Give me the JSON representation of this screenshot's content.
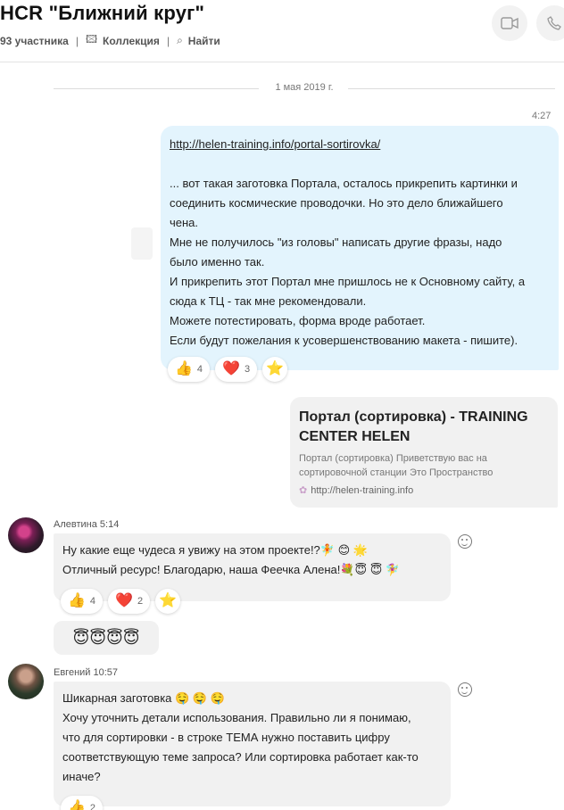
{
  "header": {
    "title": "HCR \"Ближний круг\"",
    "participants": "93 участника",
    "collection_label": "Коллекция",
    "find_label": "Найти"
  },
  "date_divider": "1 мая 2019 г.",
  "outgoing": {
    "time": "4:27",
    "link": "http://helen-training.info/portal-sortirovka/",
    "lines": [
      "... вот такая заготовка Портала, осталось прикрепить картинки и",
      "соединить космические проводочки. Но это дело ближайшего",
      "чена.",
      "Мне не получилось \"из головы\" написать другие фразы, надо",
      "было именно так.",
      "И прикрепить этот Портал мне пришлось не к Основному сайту, а",
      "сюда к ТЦ - так мне рекомендовали.",
      "Можете потестировать, форма вроде работает.",
      "Если будут пожелания к усовершенствованию макета - пишите)."
    ],
    "reactions": [
      {
        "emoji": "👍",
        "count": "4"
      },
      {
        "emoji": "❤️",
        "count": "3"
      },
      {
        "emoji": "⭐",
        "count": ""
      }
    ]
  },
  "link_card": {
    "title": "Портал (сортировка) - TRAINING CENTER HELEN",
    "description": "Портал (сортировка) Приветствую вас на сортировочной станции Это Пространство",
    "url": "http://helen-training.info"
  },
  "msg1": {
    "sender": "Алевтина 5:14",
    "lines": [
      "Ну какие еще чудеса я увижу на этом проекте!?🧚 😊 🌟",
      "Отличный ресурс!  Благодарю, наша Феечка Алена!💐😇 😇 🧚‍♀️"
    ],
    "reactions": [
      {
        "emoji": "👍",
        "count": "4"
      },
      {
        "emoji": "❤️",
        "count": "2"
      },
      {
        "emoji": "⭐",
        "count": ""
      }
    ],
    "emoji_row": "😇😇😇😇"
  },
  "msg2": {
    "sender": "Евгений 10:57",
    "lines": [
      "Шикарная заготовка 🤤 🤤 🤤",
      "Хочу уточнить детали использования. Правильно ли я понимаю,",
      "что для сортировки - в строке ТЕМА нужно поставить цифру",
      "соответствующую теме запроса? Или сортировка работает как-то",
      "иначе?"
    ],
    "reaction": {
      "emoji": "👍",
      "count": "2"
    }
  }
}
